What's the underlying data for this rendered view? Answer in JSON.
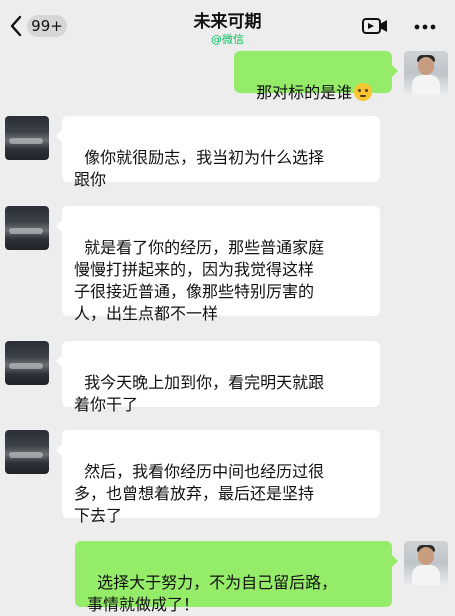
{
  "header": {
    "badge": "99+",
    "title": "未来可期",
    "subtitle": "@微信"
  },
  "icons": {
    "back": "chevron-left-icon",
    "video": "video-call-icon",
    "more": "more-dots-icon"
  },
  "messages": [
    {
      "sender": "me",
      "text": "那对标的是谁",
      "emoji": "thinking-face"
    },
    {
      "sender": "other",
      "text": "像你就很励志，我当初为什么选择\n跟你"
    },
    {
      "sender": "other",
      "text": "就是看了你的经历，那些普通家庭\n慢慢打拼起来的，因为我觉得这样\n子很接近普通，像那些特别厉害的\n人，出生点都不一样"
    },
    {
      "sender": "other",
      "text": "我今天晚上加到你，看完明天就跟\n着你干了"
    },
    {
      "sender": "other",
      "text": "然后，我看你经历中间也经历过很\n多，也曾想着放弃，最后还是坚持\n下去了"
    },
    {
      "sender": "me",
      "text": "选择大于努力，不为自己留后路，\n事情就做成了！"
    }
  ],
  "colors": {
    "background": "#ededed",
    "my_bubble": "#95ec69",
    "other_bubble": "#ffffff",
    "accent": "#07c160"
  }
}
